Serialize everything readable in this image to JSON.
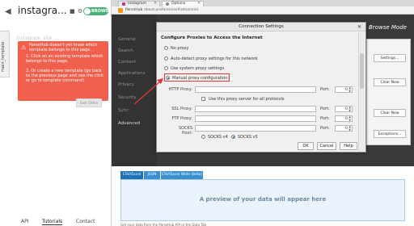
{
  "parsehub": {
    "title": "instagra...",
    "toggle_label": "BROWSE",
    "side_tab": "main_template",
    "ghost_text": "instagram_site_...",
    "alert": {
      "heading": "ParseHub doesn't yet know which template belongs to this page.",
      "step1": "1. Click on an existing template which belongs to this page.",
      "step2": "2. Or create a new template (go back to the previous page and use the click or go to template command)"
    },
    "get_data": "Get Data",
    "bottom_tabs": [
      "API",
      "Tutorials",
      "Contact"
    ]
  },
  "browser": {
    "tabs": [
      {
        "label": "Instagram",
        "active": false
      },
      {
        "label": "Options",
        "active": true
      }
    ],
    "url_name": "ParseHub",
    "url": "about:preferences#advanced"
  },
  "prefs": {
    "sidebar": [
      "General",
      "Search",
      "Content",
      "Applications",
      "Privacy",
      "Security",
      "Sync",
      "Advanced"
    ],
    "active_index": 7,
    "browse_mode": "Browse Mode",
    "right_buttons": [
      "Settings...",
      "Clear Now",
      "Clear Now",
      "Exceptions..."
    ]
  },
  "dialog": {
    "title": "Connection Settings",
    "close": "✕",
    "section_title": "Configure Proxies to Access the Internet",
    "options": [
      {
        "label": "No proxy",
        "selected": false
      },
      {
        "label": "Auto-detect proxy settings for this network",
        "selected": false
      },
      {
        "label": "Use system proxy settings",
        "selected": false
      },
      {
        "label": "Manual proxy configuration:",
        "selected": true
      }
    ],
    "fields": {
      "http_label": "HTTP Proxy:",
      "use_same": "Use this proxy server for all protocols",
      "ssl_label": "SSL Proxy:",
      "ftp_label": "FTP Proxy:",
      "socks_label": "SOCKS Host:",
      "port_label": "Port:",
      "port_value": "0",
      "socks_v4": "SOCKS v4",
      "socks_v5": "SOCKS v5"
    },
    "buttons": {
      "ok": "OK",
      "cancel": "Cancel",
      "help": "Help"
    }
  },
  "preview": {
    "tabs": [
      "CSV/Excel",
      "JSON",
      "CSV/Excel Wide (beta)"
    ],
    "placeholder": "A preview of your data will appear here",
    "bottom_text": "Get your data from the ParseHub API or the Data Tab"
  },
  "colors": {
    "alert_red": "#f0604d",
    "toggle_green": "#49b27a",
    "annotation_red": "#e23434",
    "preview_blue": "#1e72b6"
  }
}
